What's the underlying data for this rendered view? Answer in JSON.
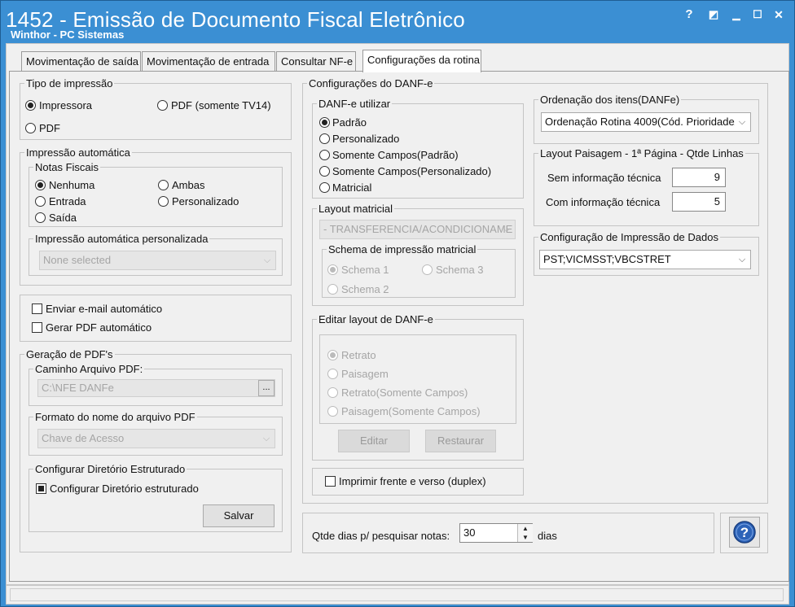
{
  "window": {
    "title": "1452 - Emissão de Documento Fiscal Eletrônico",
    "subtitle": "Winthor - PC Sistemas",
    "buttons": {
      "help": "?",
      "restore": "◩",
      "minimize": "▁",
      "maximize": "☐",
      "close": "✕"
    }
  },
  "tabs": [
    "Movimentação de saída",
    "Movimentação de entrada",
    "Consultar NF-e",
    "Configurações da rotina"
  ],
  "tipo_impressao": {
    "title": "Tipo de impressão",
    "options": [
      "Impressora",
      "PDF (somente TV14)",
      "PDF"
    ]
  },
  "impressao_automatica": {
    "title": "Impressão automática",
    "notas_title": "Notas Fiscais",
    "notas_options": [
      "Nenhuma",
      "Ambas",
      "Entrada",
      "Personalizado",
      "Saída"
    ],
    "personalizada_title": "Impressão automática personalizada",
    "personalizada_value": "None selected"
  },
  "email": {
    "enviar": "Enviar e-mail automático",
    "gerar_pdf": "Gerar PDF automático"
  },
  "geracao_pdf": {
    "title": "Geração de PDF's",
    "caminho_title": "Caminho Arquivo PDF:",
    "caminho_value": "C:\\NFE DANFe",
    "browse": "...",
    "formato_title": "Formato do nome do arquivo PDF",
    "formato_value": "Chave de Acesso",
    "dir_title": "Configurar Diretório Estruturado",
    "dir_checkbox": "Configurar Diretório estruturado",
    "salvar": "Salvar"
  },
  "danfe": {
    "title": "Configurações do DANF-e",
    "utilizar_title": "DANF-e utilizar",
    "utilizar_options": [
      "Padrão",
      "Personalizado",
      "Somente Campos(Padrão)",
      "Somente Campos(Personalizado)",
      "Matricial"
    ],
    "layout_matricial_title": "Layout matricial",
    "layout_matricial_value": "- TRANSFERENCIA/ACONDICIONAME",
    "schema_title": "Schema de impressão matricial",
    "schema_options": [
      "Schema 1",
      "Schema 3",
      "Schema 2"
    ],
    "editar_title": "Editar layout de DANF-e",
    "editar_options": [
      "Retrato",
      "Paisagem",
      "Retrato(Somente Campos)",
      "Paisagem(Somente Campos)"
    ],
    "editar_btn": "Editar",
    "restaurar_btn": "Restaurar",
    "duplex": "Imprimir frente e verso (duplex)"
  },
  "ordenacao": {
    "title": "Ordenação dos itens(DANFe)",
    "value": "Ordenação Rotina 4009(Cód. Prioridade/"
  },
  "layout_paisagem": {
    "title": "Layout Paisagem - 1ª Página - Qtde Linhas",
    "sem_label": "Sem informação técnica",
    "sem_value": "9",
    "com_label": "Com informação técnica",
    "com_value": "5"
  },
  "config_dados": {
    "title": "Configuração de Impressão de Dados",
    "value": "PST;VICMSST;VBCSTRET"
  },
  "qtde_dias": {
    "label": "Qtde dias p/ pesquisar notas:",
    "value": "30",
    "unit": "dias"
  },
  "colors": {
    "titlebar": "#3b8fd3",
    "panel": "#f0f0f0",
    "help_icon": "#2d63b8"
  }
}
